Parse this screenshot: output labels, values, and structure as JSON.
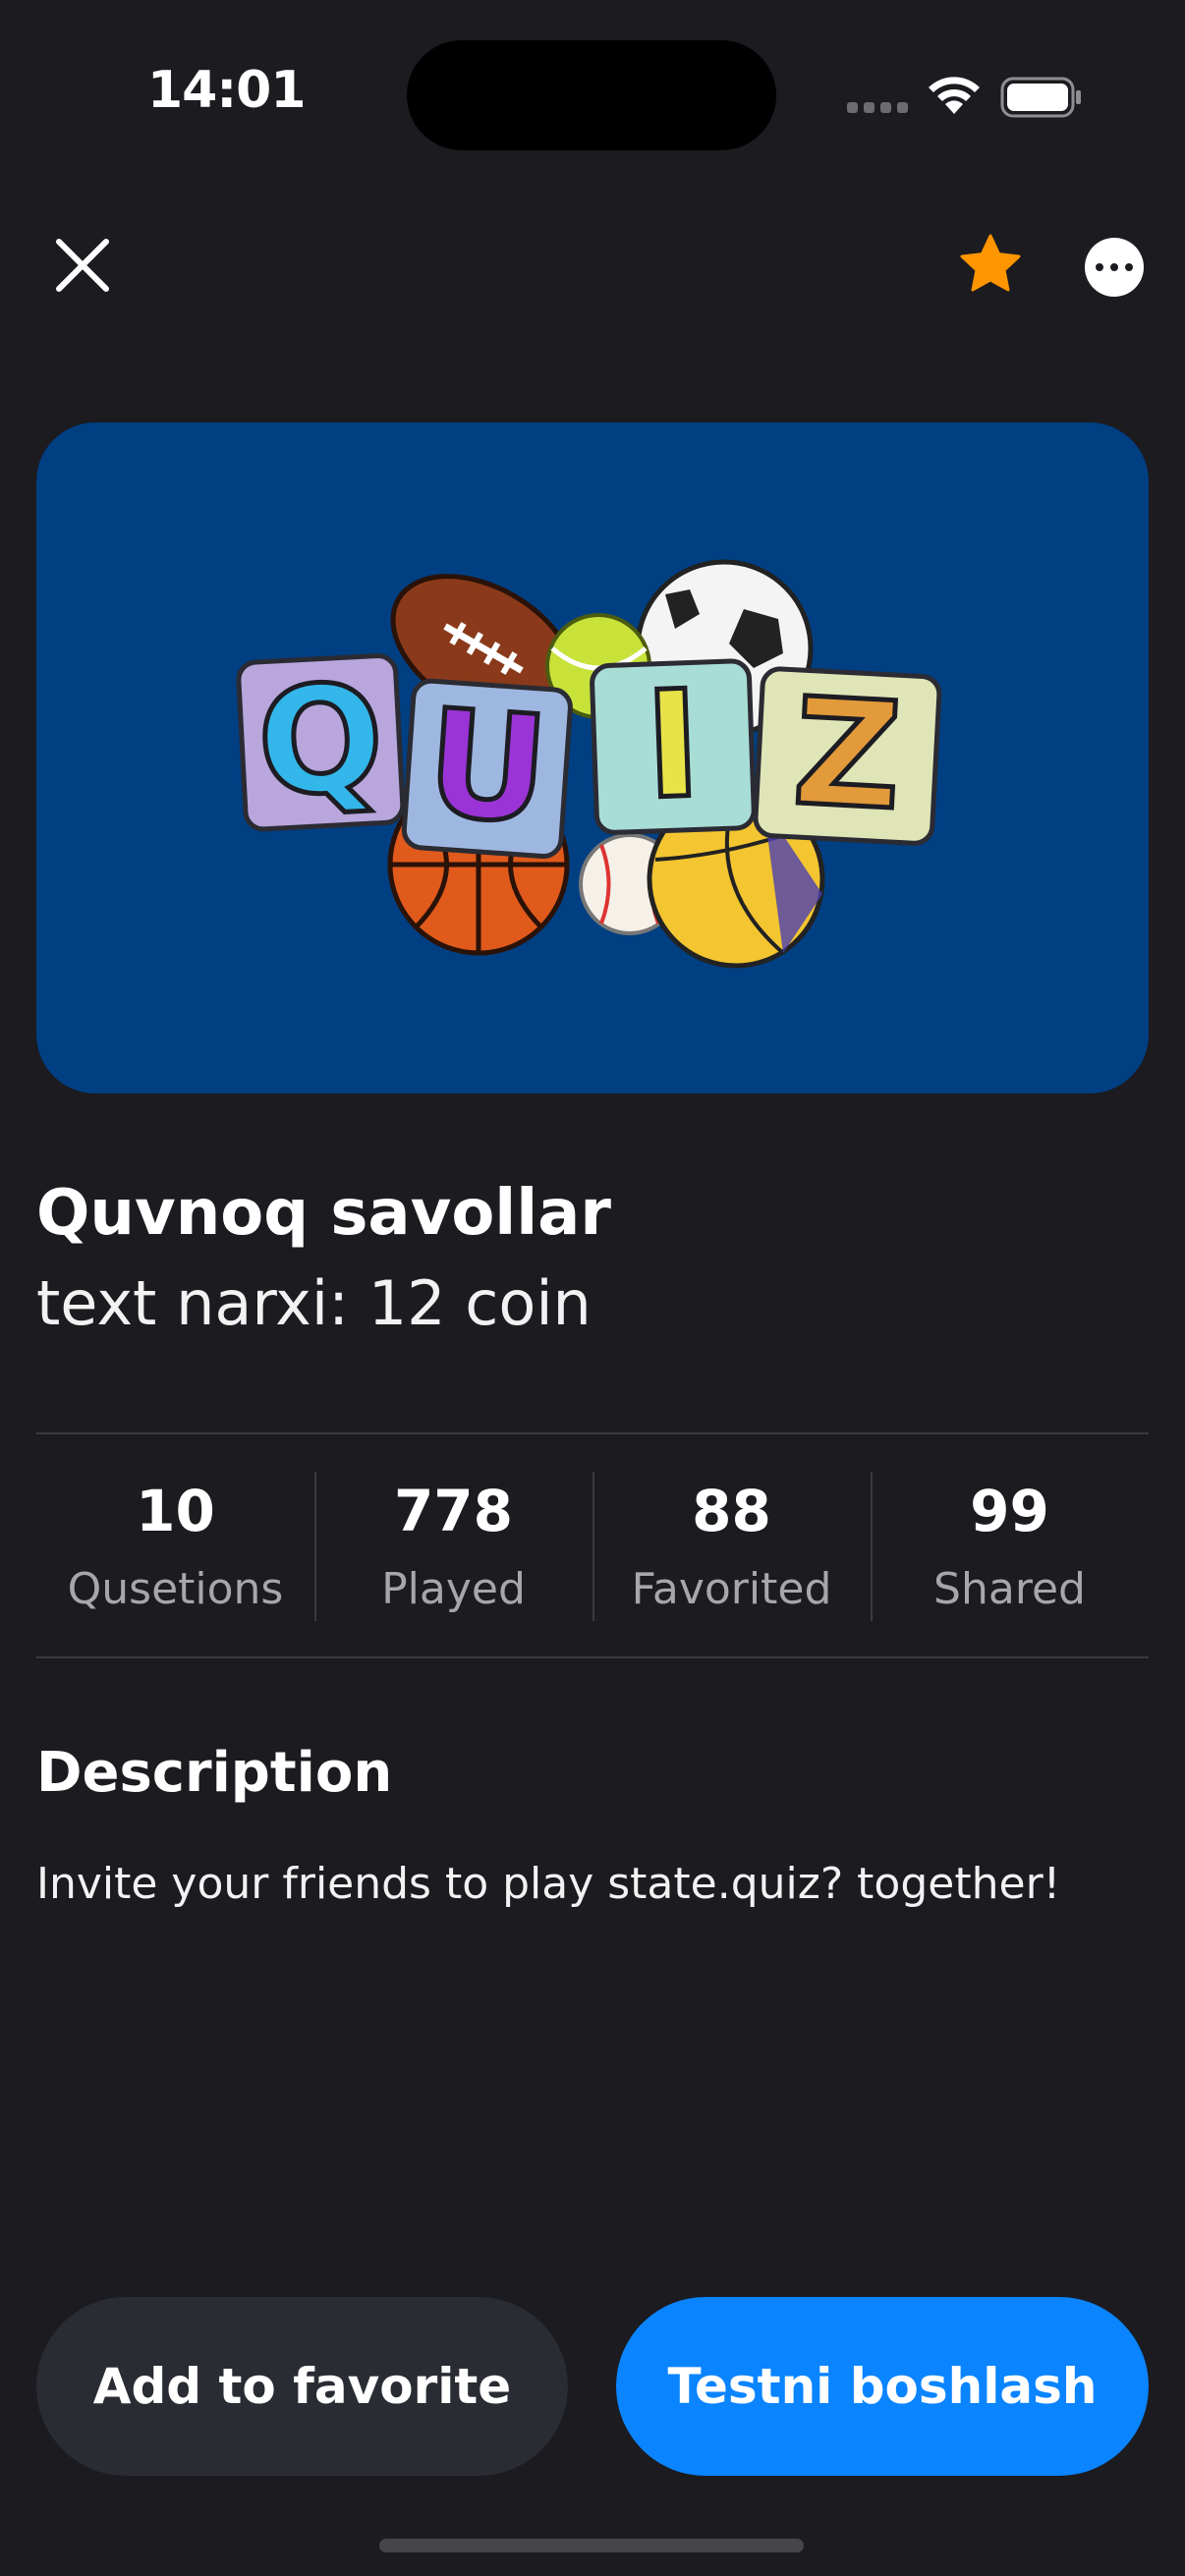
{
  "status_bar": {
    "time": "14:01"
  },
  "nav": {
    "close_icon": "close-icon",
    "favorite_icon": "star-icon",
    "more_icon": "more-icon",
    "favorite_color": "#ff9500"
  },
  "hero": {
    "logo_text": "QUIZ",
    "background": "#003f82"
  },
  "quiz": {
    "title": "Quvnoq savollar",
    "subtitle": "text narxi: 12 coin"
  },
  "stats": [
    {
      "value": "10",
      "label": "Qusetions"
    },
    {
      "value": "778",
      "label": "Played"
    },
    {
      "value": "88",
      "label": "Favorited"
    },
    {
      "value": "99",
      "label": "Shared"
    }
  ],
  "description": {
    "heading": "Description",
    "text": "Invite your friends to play state.quiz? together!"
  },
  "actions": {
    "favorite_label": "Add to favorite",
    "start_label": "Testni boshlash",
    "accent": "#0a84ff"
  }
}
